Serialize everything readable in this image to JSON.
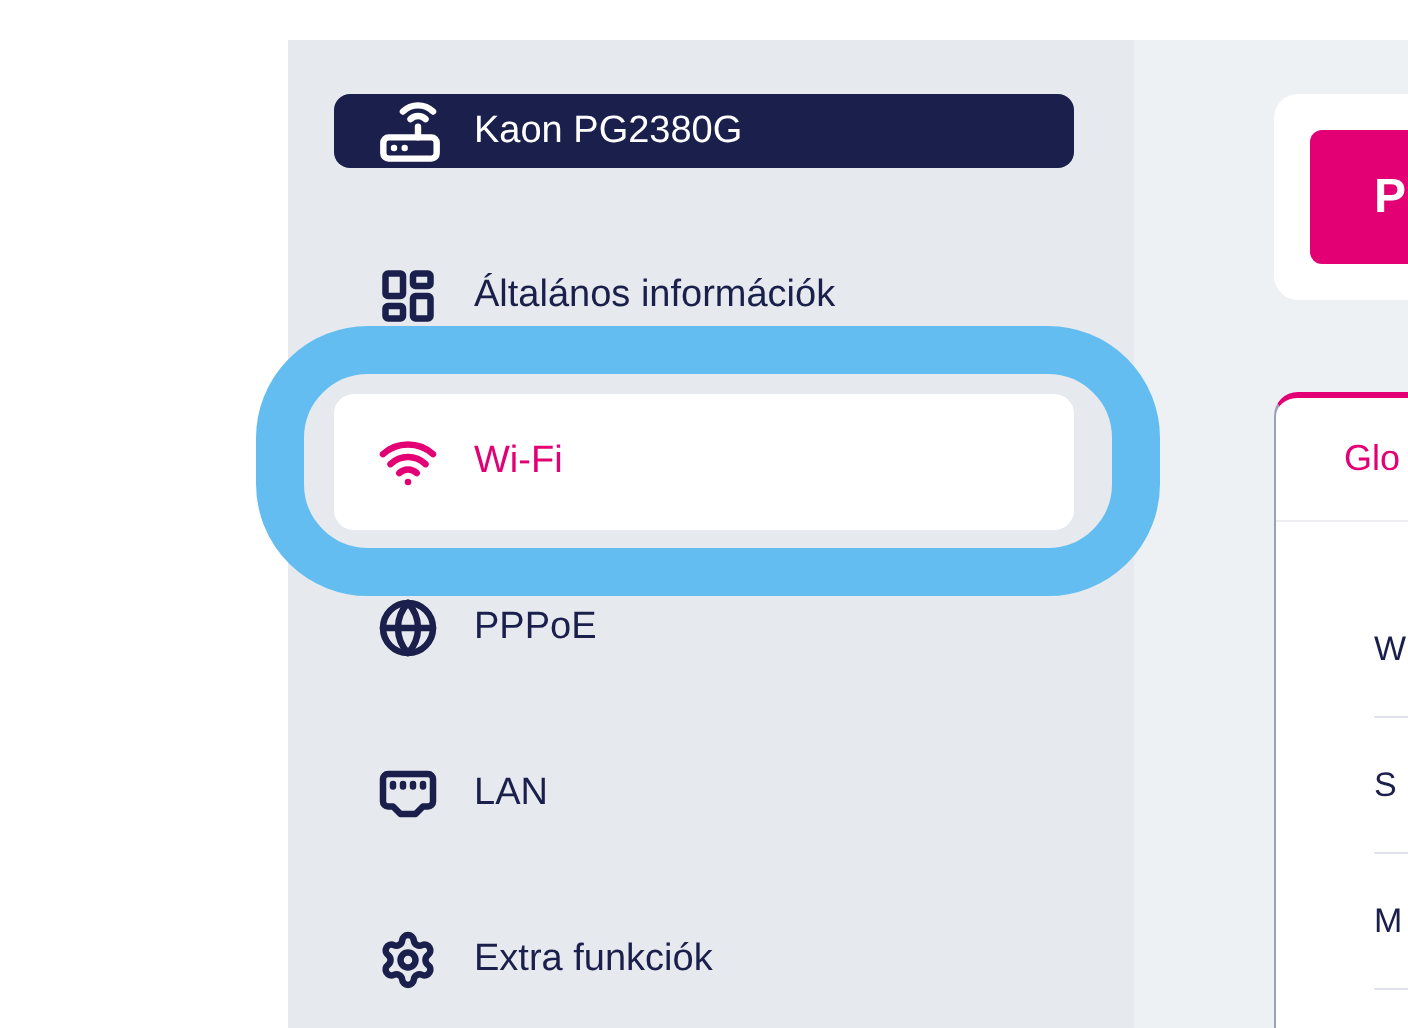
{
  "device": {
    "name": "Kaon PG2380G"
  },
  "nav": [
    {
      "label": "Általános információk",
      "selected": false,
      "highlighted": false
    },
    {
      "label": "Wi-Fi",
      "selected": true,
      "highlighted": true
    },
    {
      "label": "PPPoE",
      "selected": false,
      "highlighted": false
    },
    {
      "label": "LAN",
      "selected": false,
      "highlighted": false
    },
    {
      "label": "Extra funkciók",
      "selected": false,
      "highlighted": false
    }
  ],
  "action_button": {
    "label": "P"
  },
  "tabs": [
    {
      "label": "Glo",
      "selected": true
    }
  ],
  "rows": [
    "W",
    "S",
    "M"
  ]
}
